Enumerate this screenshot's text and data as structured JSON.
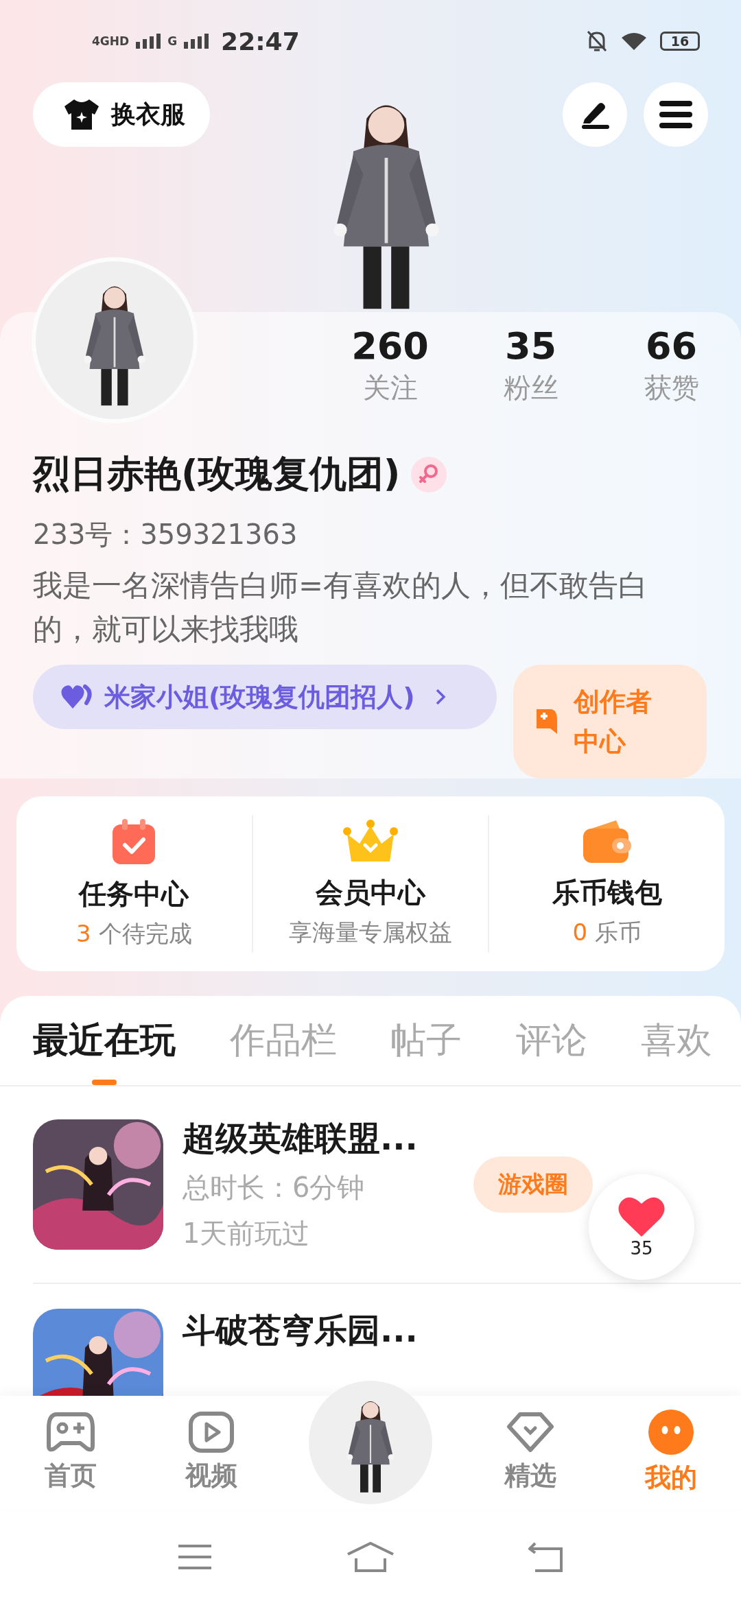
{
  "status_bar": {
    "network_1": "4GHD",
    "network_2": "G",
    "time": "22:47",
    "battery": "16"
  },
  "header": {
    "outfit_button": "换衣服"
  },
  "profile": {
    "stats": [
      {
        "value": "260",
        "label": "关注"
      },
      {
        "value": "35",
        "label": "粉丝"
      },
      {
        "value": "66",
        "label": "获赞"
      }
    ],
    "name": "烈日赤艳(玫瑰复仇团)",
    "id_line": "233号：359321363",
    "bio": "我是一名深情告白师=有喜欢的人，但不敢告白的，就可以来找我哦",
    "group_tag": "米家小姐(玫瑰复仇团招人)",
    "creator_button": "创作者中心"
  },
  "services": [
    {
      "kind": "tasks",
      "title": "任务中心",
      "count": "3",
      "subtitle": "个待完成"
    },
    {
      "kind": "vip",
      "title": "会员中心",
      "subtitle": "享海量专属权益"
    },
    {
      "kind": "wallet",
      "title": "乐币钱包",
      "count": "0",
      "subtitle": "乐币"
    }
  ],
  "tabs": [
    {
      "label": "最近在玩",
      "selected": true
    },
    {
      "label": "作品栏",
      "selected": false
    },
    {
      "label": "帖子",
      "selected": false
    },
    {
      "label": "评论",
      "selected": false
    },
    {
      "label": "喜欢",
      "selected": false
    }
  ],
  "games": [
    {
      "title": "超级英雄联盟...",
      "duration": "总时长：6分钟",
      "last_played": "1天前玩过",
      "circle_button": "游戏圈"
    },
    {
      "title": "斗破苍穹乐园..."
    }
  ],
  "floating_like": {
    "count": "35"
  },
  "bottom_nav": [
    {
      "kind": "home",
      "label": "首页",
      "selected": false
    },
    {
      "kind": "video",
      "label": "视频",
      "selected": false
    },
    {
      "kind": "avatar",
      "selected": false
    },
    {
      "kind": "featured",
      "label": "精选",
      "selected": false
    },
    {
      "kind": "mine",
      "label": "我的",
      "selected": true
    }
  ]
}
